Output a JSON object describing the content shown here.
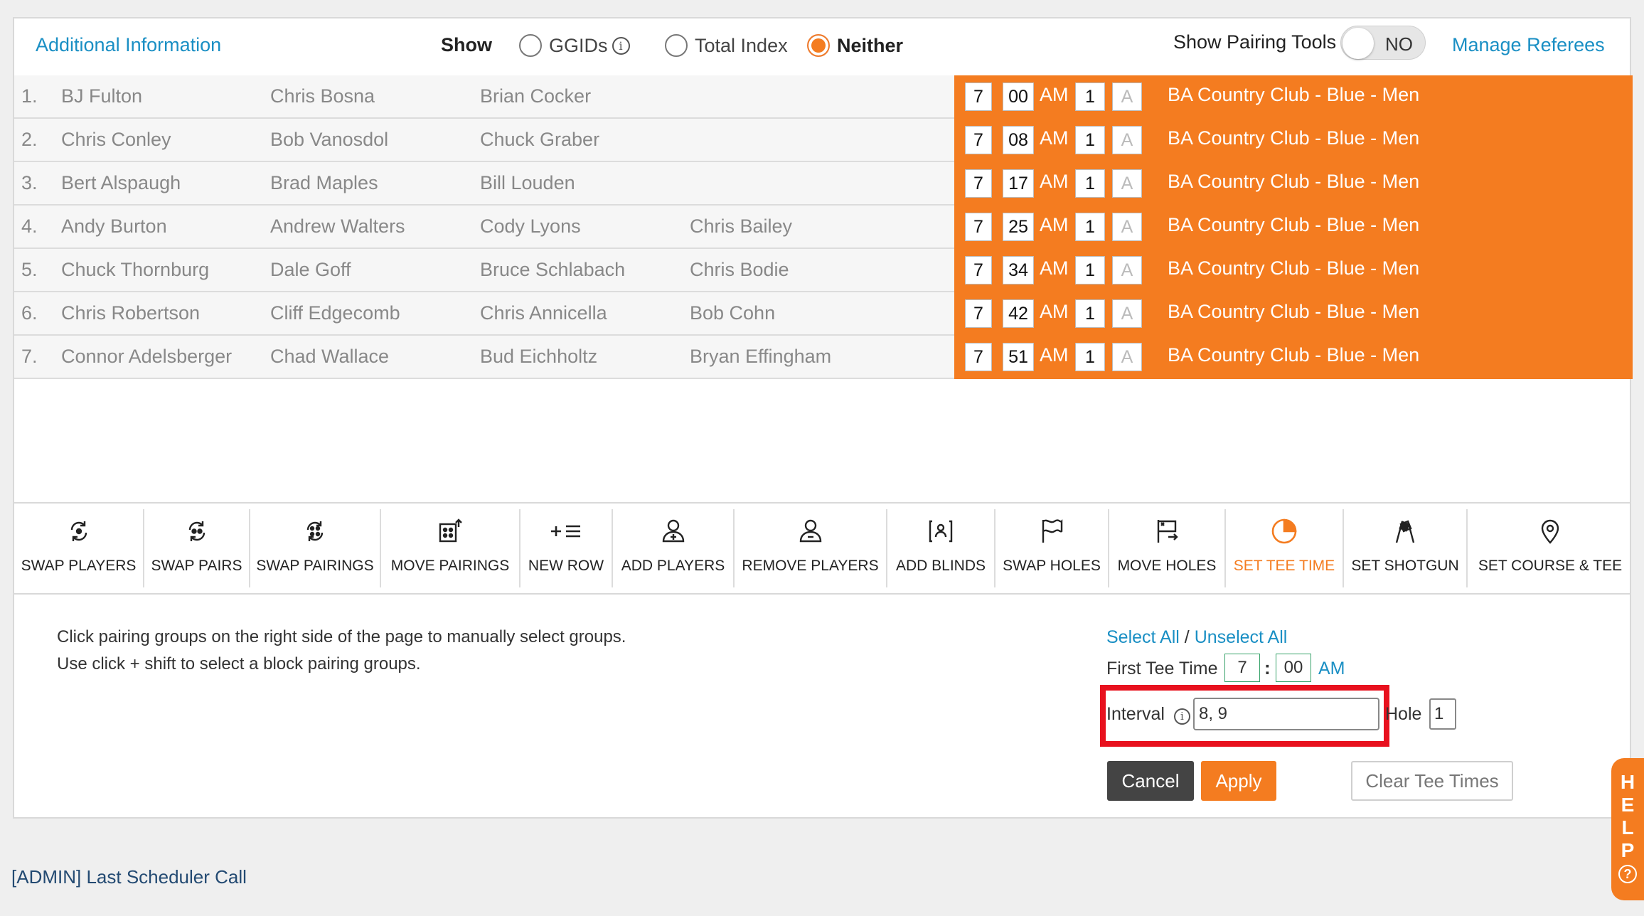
{
  "header": {
    "additional_info": "Additional Information",
    "show_label": "Show",
    "radio_options": [
      {
        "label": "GGIDs",
        "selected": false
      },
      {
        "label": "Total Index",
        "selected": false
      },
      {
        "label": "Neither",
        "selected": true
      }
    ],
    "info_glyph": "i",
    "pairing_tools_label": "Show Pairing Tools",
    "pairing_tools_toggle": "NO",
    "manage_referees": "Manage Referees"
  },
  "pairings": [
    {
      "num": "1.",
      "players": [
        "BJ Fulton",
        "Chris Bosna",
        "Brian Cocker",
        ""
      ],
      "hour": "7",
      "minute": "00",
      "ampm": "AM",
      "hole": "1",
      "tee": "A",
      "course": "BA Country Club - Blue - Men"
    },
    {
      "num": "2.",
      "players": [
        "Chris Conley",
        "Bob Vanosdol",
        "Chuck Graber",
        ""
      ],
      "hour": "7",
      "minute": "08",
      "ampm": "AM",
      "hole": "1",
      "tee": "A",
      "course": "BA Country Club - Blue - Men"
    },
    {
      "num": "3.",
      "players": [
        "Bert Alspaugh",
        "Brad Maples",
        "Bill Louden",
        ""
      ],
      "hour": "7",
      "minute": "17",
      "ampm": "AM",
      "hole": "1",
      "tee": "A",
      "course": "BA Country Club - Blue - Men"
    },
    {
      "num": "4.",
      "players": [
        "Andy Burton",
        "Andrew Walters",
        "Cody Lyons",
        "Chris Bailey"
      ],
      "hour": "7",
      "minute": "25",
      "ampm": "AM",
      "hole": "1",
      "tee": "A",
      "course": "BA Country Club - Blue - Men"
    },
    {
      "num": "5.",
      "players": [
        "Chuck Thornburg",
        "Dale Goff",
        "Bruce Schlabach",
        "Chris Bodie"
      ],
      "hour": "7",
      "minute": "34",
      "ampm": "AM",
      "hole": "1",
      "tee": "A",
      "course": "BA Country Club - Blue - Men"
    },
    {
      "num": "6.",
      "players": [
        "Chris Robertson",
        "Cliff Edgecomb",
        "Chris Annicella",
        "Bob Cohn"
      ],
      "hour": "7",
      "minute": "42",
      "ampm": "AM",
      "hole": "1",
      "tee": "A",
      "course": "BA Country Club - Blue - Men"
    },
    {
      "num": "7.",
      "players": [
        "Connor Adelsberger",
        "Chad Wallace",
        "Bud Eichholtz",
        "Bryan Effingham"
      ],
      "hour": "7",
      "minute": "51",
      "ampm": "AM",
      "hole": "1",
      "tee": "A",
      "course": "BA Country Club - Blue - Men"
    }
  ],
  "toolbar": [
    {
      "label": "SWAP PLAYERS",
      "icon": "swap-players-icon"
    },
    {
      "label": "SWAP PAIRS",
      "icon": "swap-pairs-icon"
    },
    {
      "label": "SWAP PAIRINGS",
      "icon": "swap-pairings-icon"
    },
    {
      "label": "MOVE PAIRINGS",
      "icon": "move-pairings-icon"
    },
    {
      "label": "NEW ROW",
      "icon": "new-row-icon"
    },
    {
      "label": "ADD PLAYERS",
      "icon": "add-players-icon"
    },
    {
      "label": "REMOVE PLAYERS",
      "icon": "remove-players-icon"
    },
    {
      "label": "ADD BLINDS",
      "icon": "add-blinds-icon"
    },
    {
      "label": "SWAP HOLES",
      "icon": "swap-holes-icon"
    },
    {
      "label": "MOVE HOLES",
      "icon": "move-holes-icon"
    },
    {
      "label": "SET TEE TIME",
      "icon": "clock-icon",
      "active": true
    },
    {
      "label": "SET SHOTGUN",
      "icon": "checkered-flags-icon"
    },
    {
      "label": "SET COURSE & TEE",
      "icon": "location-pin-icon"
    }
  ],
  "tee_time_panel": {
    "instruction_1": "Click pairing groups on the right side of the page to manually select groups.",
    "instruction_2": "Use click + shift to select a block pairing groups.",
    "select_all": "Select All",
    "separator": "/",
    "unselect_all": "Unselect All",
    "first_tee_time_label": "First Tee Time",
    "first_hour": "7",
    "colon": ":",
    "first_minute": "00",
    "first_ampm": "AM",
    "interval_label": "Interval",
    "interval_value": "8, 9",
    "hole_label": "Hole",
    "hole_value": "1",
    "cancel": "Cancel",
    "apply": "Apply",
    "clear": "Clear Tee Times"
  },
  "footer": {
    "admin_link": "[ADMIN] Last Scheduler Call",
    "help_letters": [
      "H",
      "E",
      "L",
      "P",
      "?"
    ]
  },
  "colors": {
    "accent_orange": "#f47c20",
    "link_blue": "#1a8fc4",
    "highlight_red": "#e8111e"
  }
}
